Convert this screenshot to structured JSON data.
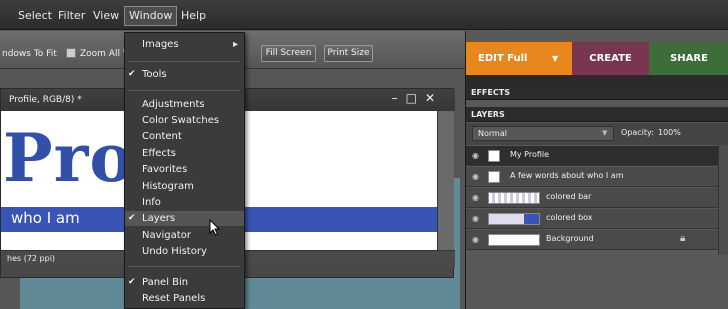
{
  "menubar": {
    "items": [
      "Select",
      "Filter",
      "View",
      "Window",
      "Help"
    ]
  },
  "toolbar": {
    "fit_label": "ndows To Fit",
    "zoom_label": "Zoom All Wi",
    "fill_screen": "Fill Screen",
    "print_size": "Print Size"
  },
  "document": {
    "title": "Profile, RGB/8) *",
    "big_text": "Pro",
    "bar_text": "who I am",
    "status": "hes (72 ppi)"
  },
  "window_menu": {
    "items": [
      {
        "label": "Images",
        "submenu": true
      },
      {
        "label": "Tools",
        "checked": true
      },
      {
        "label": "Adjustments"
      },
      {
        "label": "Color Swatches"
      },
      {
        "label": "Content"
      },
      {
        "label": "Effects"
      },
      {
        "label": "Favorites"
      },
      {
        "label": "Histogram"
      },
      {
        "label": "Info"
      },
      {
        "label": "Layers",
        "checked": true,
        "highlighted": true
      },
      {
        "label": "Navigator"
      },
      {
        "label": "Undo History"
      },
      {
        "label": "Panel Bin",
        "checked": true
      },
      {
        "label": "Reset Panels"
      }
    ]
  },
  "mode_tabs": {
    "edit": "EDIT Full",
    "create": "CREATE",
    "share": "SHARE"
  },
  "panels": {
    "effects": "EFFECTS",
    "layers": "LAYERS",
    "blend_mode": "Normal",
    "opacity_label": "Opacity:",
    "opacity_value": "100%"
  },
  "layers": [
    {
      "name": "My Profile",
      "selected": true
    },
    {
      "name": "A few words about who I am"
    },
    {
      "name": "colored bar"
    },
    {
      "name": "colored box"
    },
    {
      "name": "Background",
      "locked": true
    }
  ],
  "colors": {
    "edit_tab": "#e8871e",
    "create_tab": "#7a3550",
    "share_tab": "#3d6e3a",
    "canvas_blue": "#3954b5"
  }
}
